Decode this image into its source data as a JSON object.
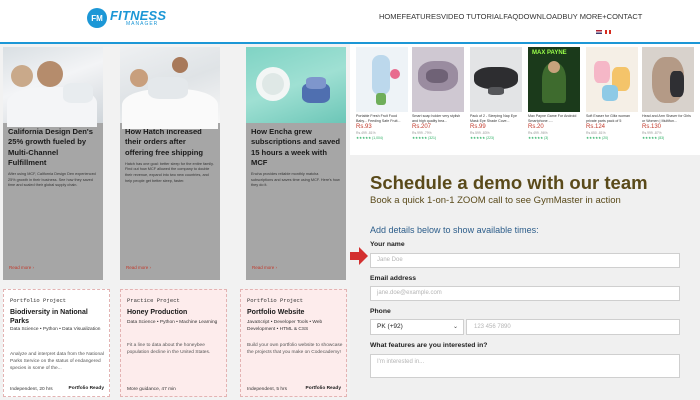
{
  "header": {
    "logo": {
      "badge": "FM",
      "name": "FITNESS",
      "sub": "MANAGER"
    },
    "nav": [
      "HOME",
      "FEATURES",
      "VIDEO TUTORIAL",
      "FAQ",
      "DOWNLOAD",
      "BUY MORE",
      "CONTACT"
    ],
    "nav_separators": [
      " ",
      " ",
      " ",
      " ",
      " ",
      "+ ",
      ""
    ],
    "flags": [
      "us-flag-icon",
      "canada-flag-icon"
    ]
  },
  "case_studies": [
    {
      "title": "California Design Den's 25% growth fueled by Multi-Channel Fulfillment",
      "desc": "After using MCF, California Design Den experienced 25% growth in their business. See how they saved time and scaled their global supply chain.",
      "more": "Read more ›"
    },
    {
      "title": "How Hatch increased their orders after offering free shipping",
      "desc": "Hatch has one goal: better sleep for the entire family. Find out how MCF allowed the company to double their revenue, expand into two new countries, and help people get better sleep, faster.",
      "more": "Read more ›"
    },
    {
      "title": "How Encha grew subscriptions and saved 15 hours a week with MCF",
      "desc": "Encha provides reliable monthly matcha subscriptions and saves time using MCF. Here's how they do it.",
      "more": "Read more ›"
    }
  ],
  "portfolio": [
    {
      "label": "Portfolio Project",
      "title": "Biodiversity in National Parks",
      "tags": "Data Science • Python • Data Visualization",
      "desc": "Analyze and interpret data from the National Parks Service on the status of endangered species in some of the...",
      "foot": "Independent, 20 hrs",
      "ready": "Portfolio Ready"
    },
    {
      "label": "Practice Project",
      "title": "Honey Production",
      "tags": "Data Science • Python • Machine Learning",
      "desc": "Fit a line to data about the honeybee population decline in the United States.",
      "foot": "More guidance, 47 min",
      "ready": ""
    },
    {
      "label": "Portfolio Project",
      "title": "Portfolio Website",
      "tags": "JavaScript • Developer Tools • Web Development • HTML & CSS",
      "desc": "Build your own portfolio website to showcase the projects that you make on Codecademy!",
      "foot": "Independent, 5 hrs",
      "ready": "Portfolio Ready"
    }
  ],
  "products": [
    {
      "name": "Portable Fresh Fruit Food Baby... Feeding Safe Fruit...",
      "price": "Rs.93",
      "old": "Rs.499 -81%",
      "stars": "★★★★★ (1,004)"
    },
    {
      "name": "Smart soap holder very stylish and high quality bea...",
      "price": "Rs.207",
      "old": "Rs.999 -79%",
      "stars": "★★★★★ (321)"
    },
    {
      "name": "Pack of 2 - Sleeping Nap Eye Mask Eye Shade Cove...",
      "price": "Rs.99",
      "old": "Rs.599 -83%",
      "stars": "★★★★★ (223)"
    },
    {
      "name": "Max Payne Game For Android Smartphone -...",
      "price": "Rs.20",
      "old": "Rs.499 -96%",
      "stars": "★★★★★ (3)"
    },
    {
      "name": "Soft Eraser for Glitz woman private parts pack of 5",
      "price": "Rs.124",
      "old": "Rs.650 -81%",
      "stars": "★★★★★ (20)"
    },
    {
      "name": "Head and Arm Shaver for Girls or Women | Multifun...",
      "price": "Rs.130",
      "old": "Rs.999 -87%",
      "stars": "★★★★★ (83)"
    }
  ],
  "product_image_texts": {
    "max_payne": "MAX PAYNE"
  },
  "schedule": {
    "title": "Schedule a demo with our team",
    "subtitle": "Book a quick 1-on-1 ZOOM call to see GymMaster in action",
    "hint": "Add details below to show available times:",
    "name_label": "Your name",
    "name_placeholder": "Jane Doe",
    "email_label": "Email address",
    "email_placeholder": "jane.doe@example.com",
    "phone_label": "Phone",
    "country_value": "PK (+92)",
    "phone_placeholder": "123 456 7890",
    "features_label": "What features are you interested in?",
    "features_placeholder": "I'm interested in..."
  },
  "colors": {
    "brand": "#1c97d6",
    "heading": "#5a4a1a",
    "hint": "#2c5d8a",
    "price": "#c0392b",
    "arrow": "#d32f2f"
  }
}
